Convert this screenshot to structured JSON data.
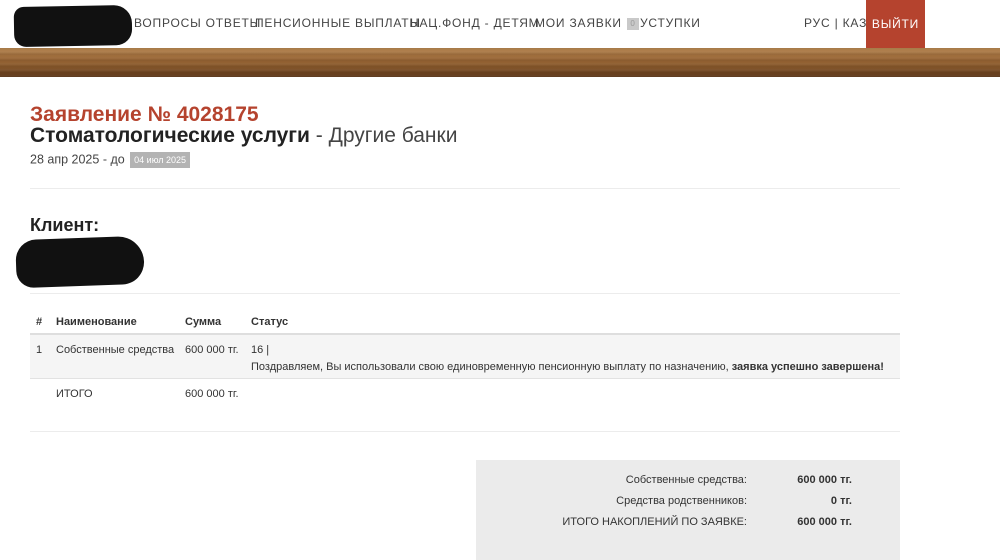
{
  "nav": {
    "items": [
      "ВОПРОСЫ ОТВЕТЫ",
      "ПЕНСИОННЫЕ ВЫПЛАТЫ",
      "НАЦ.ФОНД - ДЕТЯМ",
      "МОИ ЗАЯВКИ"
    ],
    "services": {
      "badge": "0",
      "label": "УСТУПКИ"
    },
    "lang_ru": "РУС",
    "lang_sep": "|",
    "lang_kz": "КАЗ",
    "logout": "ВЫЙТИ"
  },
  "application": {
    "number": "Заявление № 4028175",
    "service": "Стоматологические услуги",
    "separator": " - ",
    "bank": "Другие банки",
    "date_from": "28 апр 2025",
    "date_until_label": " - до ",
    "date_until": "04 июл 2025"
  },
  "client": {
    "label": "Клиент:"
  },
  "table": {
    "headers": [
      "#",
      "Наименование",
      "Сумма",
      "Статус"
    ],
    "rows": [
      {
        "num": "1",
        "name": "Собственные средства",
        "sum": "600 000 тг.",
        "status_code": "16 |",
        "status_msg": "Поздравляем, Вы использовали свою единовременную пенсионную выплату по назначению, ",
        "status_bold": "заявка успешно завершена!"
      }
    ],
    "total": {
      "label": "ИТОГО",
      "sum": "600 000 тг."
    }
  },
  "summary": [
    {
      "label": "Собственные средства:",
      "value": "600 000 тг."
    },
    {
      "label": "Средства родственников:",
      "value": "0 тг."
    },
    {
      "label": "ИТОГО НАКОПЛЕНИЙ ПО ЗАЯВКЕ:",
      "value": "600 000 тг."
    }
  ],
  "colors": {
    "accent": "#b5432e",
    "banner": "#8a5a2c",
    "summary_bg": "#ebebeb"
  }
}
